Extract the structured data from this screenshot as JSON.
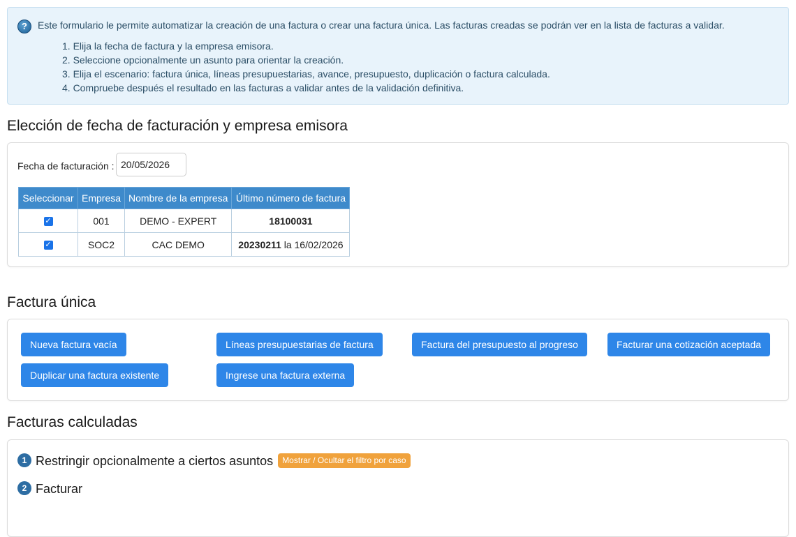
{
  "info": {
    "icon": "help-question-icon",
    "intro": "Este formulario le permite automatizar la creación de una factura o crear una factura única. Las facturas creadas se podrán ver en la lista de facturas a validar.",
    "steps": [
      "1. Elija la fecha de factura y la empresa emisora.",
      "2. Seleccione opcionalmente un asunto para orientar la creación.",
      "3. Elija el escenario: factura única, líneas presupuestarias, avance, presupuesto, duplicación o factura calculada.",
      "4. Compruebe después el resultado en las facturas a validar antes de la validación definitiva."
    ]
  },
  "section_dates": {
    "title": "Elección de fecha de facturación y empresa emisora",
    "date_label": "Fecha de facturación :",
    "date_value": "20/05/2026",
    "table": {
      "headers": [
        "Seleccionar",
        "Empresa",
        "Nombre de la empresa",
        "Último número de factura"
      ],
      "rows": [
        {
          "selected": true,
          "code": "001",
          "name": "DEMO - EXPERT",
          "last_number": "18100031",
          "last_date": ""
        },
        {
          "selected": true,
          "code": "SOC2",
          "name": "CAC DEMO",
          "last_number": "20230211",
          "last_date": "la 16/02/2026"
        }
      ]
    }
  },
  "section_single": {
    "title": "Factura única",
    "buttons": [
      "Nueva factura vacía",
      "Líneas presupuestarias de factura",
      "Factura del presupuesto al progreso",
      "Facturar una cotización aceptada",
      "Duplicar una factura existente",
      "Ingrese una factura externa"
    ]
  },
  "section_calculated": {
    "title": "Facturas calculadas",
    "step1_num": "1",
    "step1_label": "Restringir opcionalmente a ciertos asuntos",
    "toggle_filter_label": "Mostrar / Ocultar el filtro por caso",
    "step2_num": "2",
    "step2_label": "Facturar"
  },
  "colors": {
    "primary_button": "#2e86e8",
    "table_header": "#3e8acb",
    "info_background": "#e8f3fb",
    "badge": "#f0a23c",
    "step_number": "#2d6da3"
  }
}
